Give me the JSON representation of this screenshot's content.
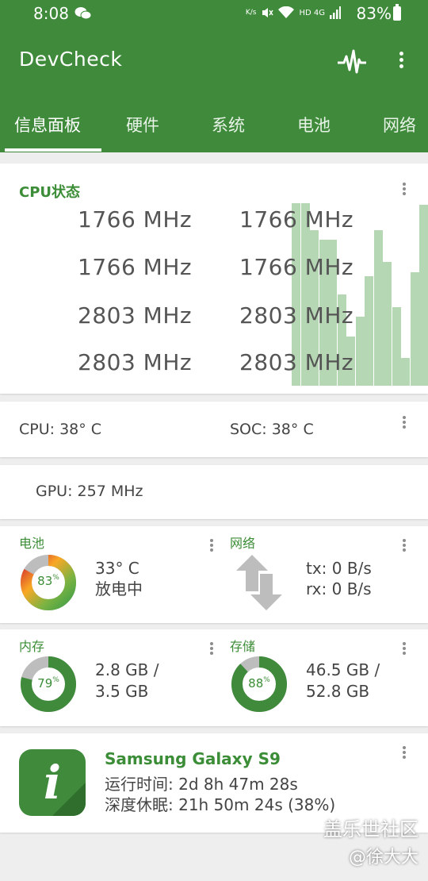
{
  "status_bar": {
    "time": "8:08",
    "icons_text": "K/s HD 4G",
    "battery_pct": "83%"
  },
  "app": {
    "title": "DevCheck",
    "tabs": [
      "信息面板",
      "硬件",
      "系统",
      "电池",
      "网络"
    ],
    "active_tab": 0
  },
  "cpu": {
    "title": "CPU状态",
    "freqs": [
      "1766 MHz",
      "1766 MHz",
      "1766 MHz",
      "1766 MHz",
      "2803 MHz",
      "2803 MHz",
      "2803 MHz",
      "2803 MHz"
    ],
    "load_history": [
      1.0,
      1.0,
      0.85,
      0.8,
      0.8,
      0.5,
      0.27,
      0.38,
      0.6,
      0.85,
      0.68,
      0.43,
      0.15,
      0.62,
      0.99
    ]
  },
  "temps": {
    "cpu": "CPU: 38° C",
    "soc": "SOC: 38° C"
  },
  "gpu": {
    "text": "GPU: 257 MHz"
  },
  "battery": {
    "title": "电池",
    "level": 0.83,
    "level_label": "83",
    "temp": "33° C",
    "status": "放电中"
  },
  "network": {
    "title": "网络",
    "tx": "tx: 0 B/s",
    "rx": "rx: 0 B/s"
  },
  "memory": {
    "title": "内存",
    "used_fraction": 0.79,
    "pct_label": "79",
    "line1": "2.8 GB /",
    "line2": "3.5 GB"
  },
  "storage": {
    "title": "存储",
    "used_fraction": 0.88,
    "pct_label": "88",
    "line1": "46.5 GB /",
    "line2": "52.8 GB"
  },
  "device": {
    "name": "Samsung Galaxy S9",
    "uptime": "运行时间: 2d 8h 47m 28s",
    "deep_sleep": "深度休眠: 21h 50m 24s (38%)"
  },
  "watermark": {
    "line1": "盖乐世社区",
    "line2": "@徐大大"
  },
  "colors": {
    "brand": "#3f8a3b",
    "accent_text": "#3c8d37",
    "bar": "#b6d7b3",
    "donut_track": "#bdbdbd"
  }
}
